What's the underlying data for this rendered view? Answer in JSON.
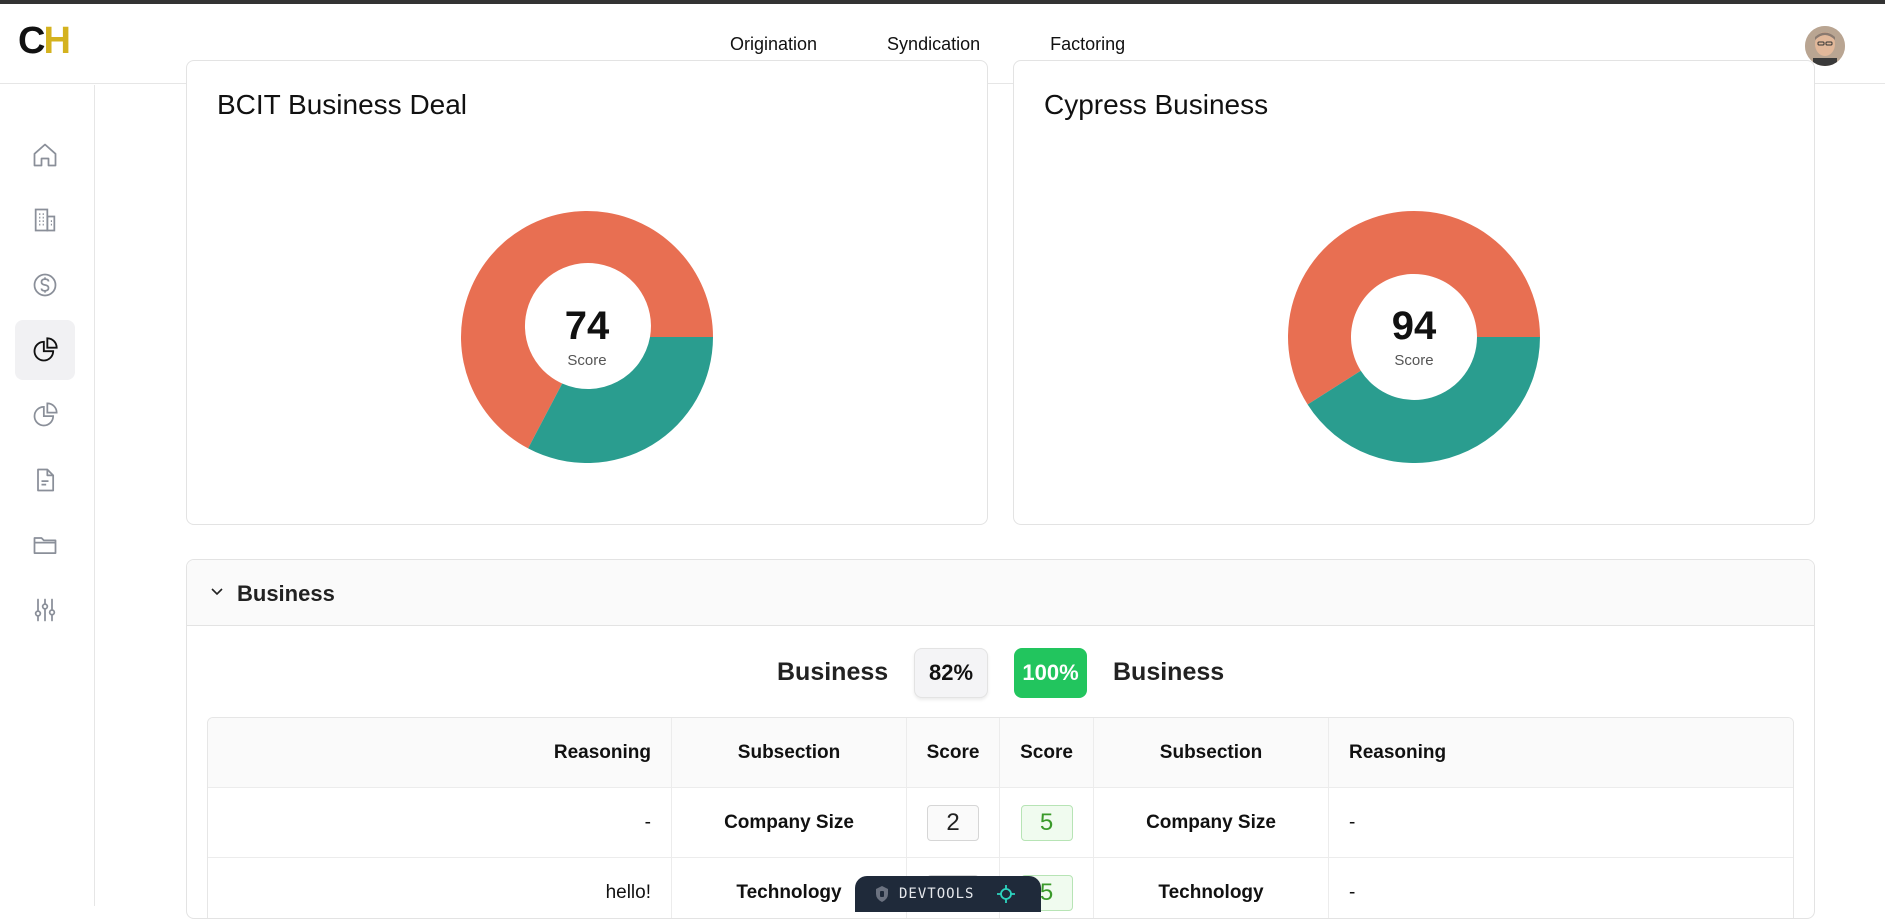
{
  "header": {
    "logo_c": "C",
    "logo_h": "H",
    "nav": [
      "Origination",
      "Syndication",
      "Factoring"
    ]
  },
  "sidebar": {
    "icons": [
      "home-icon",
      "building-icon",
      "dollar-icon",
      "pie-chart-icon",
      "pie-chart-outline-icon",
      "document-icon",
      "folder-icon",
      "sliders-icon"
    ],
    "active_index": 3
  },
  "cards": [
    {
      "title": "BCIT Business Deal",
      "score": "74",
      "score_label": "Score"
    },
    {
      "title": "Cypress Business",
      "score": "94",
      "score_label": "Score"
    }
  ],
  "section": {
    "title": "Business",
    "left_label": "Business",
    "left_pct": "82%",
    "right_pct": "100%",
    "right_label": "Business",
    "table": {
      "headers": [
        "Reasoning",
        "Subsection",
        "Score",
        "Score",
        "Subsection",
        "Reasoning"
      ],
      "rows": [
        {
          "left_reasoning": "-",
          "left_subsection": "Company Size",
          "left_score": "2",
          "right_score": "5",
          "right_subsection": "Company Size",
          "right_reasoning": "-"
        },
        {
          "left_reasoning": "hello!",
          "left_subsection": "Technology",
          "left_score": "",
          "right_score": "5",
          "right_subsection": "Technology",
          "right_reasoning": "-"
        }
      ]
    }
  },
  "devtools": {
    "label": "DEVTOOLS"
  },
  "colors": {
    "coral": "#e86f52",
    "teal": "#2a9d8f",
    "green": "#22c55e",
    "logo_gold": "#d4b21e"
  }
}
